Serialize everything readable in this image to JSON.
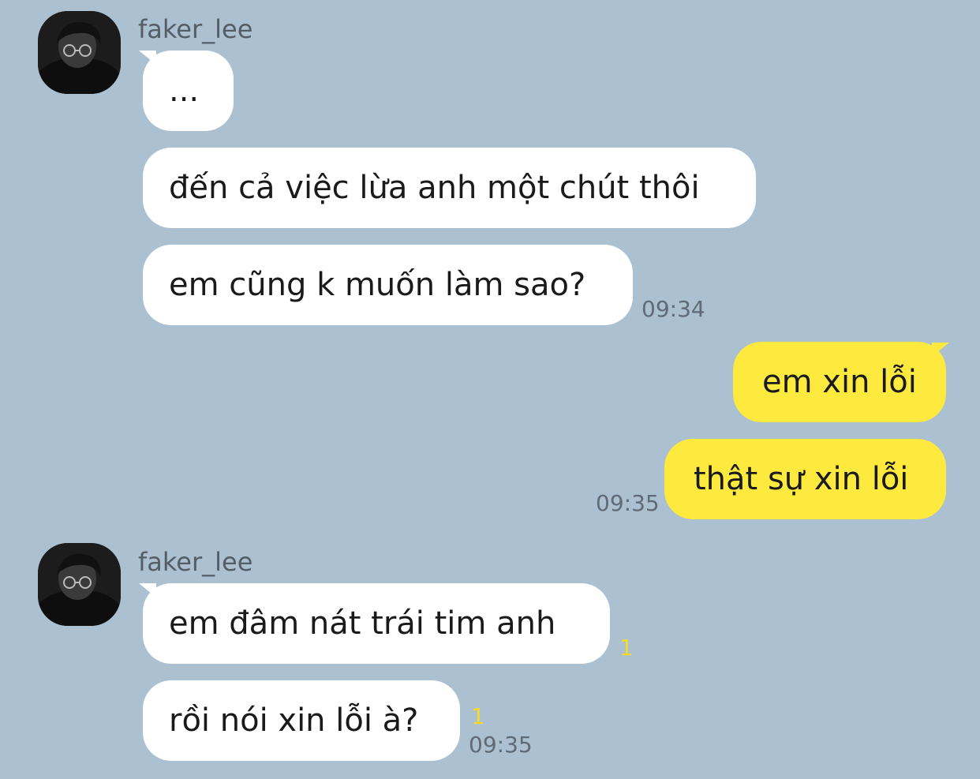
{
  "messages": {
    "group1": {
      "sender": "faker_lee",
      "bubbles": [
        "...",
        "đến cả việc lừa anh một chút thôi",
        "em cũng k muốn làm sao?"
      ],
      "time": "09:34"
    },
    "group2": {
      "bubbles": [
        "em xin lỗi",
        "thật sự xin lỗi"
      ],
      "time": "09:35"
    },
    "group3": {
      "sender": "faker_lee",
      "bubbles": [
        "em đâm nát trái tim anh",
        "rồi nói xin lỗi à?"
      ],
      "unread": [
        "1",
        "1"
      ],
      "time": "09:35"
    }
  },
  "colors": {
    "background": "#abc1d1",
    "incoming_bubble": "#ffffff",
    "outgoing_bubble": "#fee93f",
    "unread_count": "#f6d92b"
  },
  "icons": {
    "avatar": "avatar-photo"
  }
}
